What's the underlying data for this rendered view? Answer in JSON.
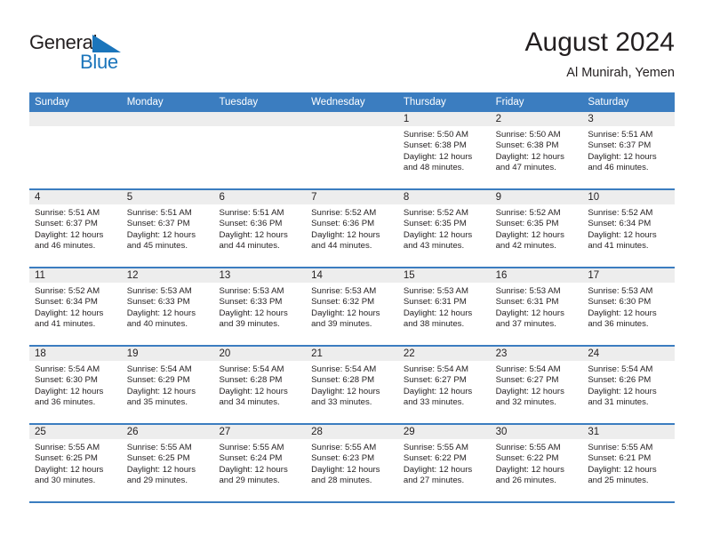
{
  "brand": {
    "word_one": "General",
    "word_two": "Blue",
    "mark": "triangle-logo-icon",
    "accent_color": "#1b75bb"
  },
  "header": {
    "title": "August 2024",
    "subtitle": "Al Munirah, Yemen"
  },
  "colors": {
    "header_blue": "#3b7dc0",
    "day_band_gray": "#ededed",
    "text": "#231f20"
  },
  "weekdays": [
    "Sunday",
    "Monday",
    "Tuesday",
    "Wednesday",
    "Thursday",
    "Friday",
    "Saturday"
  ],
  "weeks": [
    [
      {
        "day": "",
        "empty": true
      },
      {
        "day": "",
        "empty": true
      },
      {
        "day": "",
        "empty": true
      },
      {
        "day": "",
        "empty": true
      },
      {
        "day": "1",
        "sunrise": "Sunrise: 5:50 AM",
        "sunset": "Sunset: 6:38 PM",
        "daylight1": "Daylight: 12 hours",
        "daylight2": "and 48 minutes."
      },
      {
        "day": "2",
        "sunrise": "Sunrise: 5:50 AM",
        "sunset": "Sunset: 6:38 PM",
        "daylight1": "Daylight: 12 hours",
        "daylight2": "and 47 minutes."
      },
      {
        "day": "3",
        "sunrise": "Sunrise: 5:51 AM",
        "sunset": "Sunset: 6:37 PM",
        "daylight1": "Daylight: 12 hours",
        "daylight2": "and 46 minutes."
      }
    ],
    [
      {
        "day": "4",
        "sunrise": "Sunrise: 5:51 AM",
        "sunset": "Sunset: 6:37 PM",
        "daylight1": "Daylight: 12 hours",
        "daylight2": "and 46 minutes."
      },
      {
        "day": "5",
        "sunrise": "Sunrise: 5:51 AM",
        "sunset": "Sunset: 6:37 PM",
        "daylight1": "Daylight: 12 hours",
        "daylight2": "and 45 minutes."
      },
      {
        "day": "6",
        "sunrise": "Sunrise: 5:51 AM",
        "sunset": "Sunset: 6:36 PM",
        "daylight1": "Daylight: 12 hours",
        "daylight2": "and 44 minutes."
      },
      {
        "day": "7",
        "sunrise": "Sunrise: 5:52 AM",
        "sunset": "Sunset: 6:36 PM",
        "daylight1": "Daylight: 12 hours",
        "daylight2": "and 44 minutes."
      },
      {
        "day": "8",
        "sunrise": "Sunrise: 5:52 AM",
        "sunset": "Sunset: 6:35 PM",
        "daylight1": "Daylight: 12 hours",
        "daylight2": "and 43 minutes."
      },
      {
        "day": "9",
        "sunrise": "Sunrise: 5:52 AM",
        "sunset": "Sunset: 6:35 PM",
        "daylight1": "Daylight: 12 hours",
        "daylight2": "and 42 minutes."
      },
      {
        "day": "10",
        "sunrise": "Sunrise: 5:52 AM",
        "sunset": "Sunset: 6:34 PM",
        "daylight1": "Daylight: 12 hours",
        "daylight2": "and 41 minutes."
      }
    ],
    [
      {
        "day": "11",
        "sunrise": "Sunrise: 5:52 AM",
        "sunset": "Sunset: 6:34 PM",
        "daylight1": "Daylight: 12 hours",
        "daylight2": "and 41 minutes."
      },
      {
        "day": "12",
        "sunrise": "Sunrise: 5:53 AM",
        "sunset": "Sunset: 6:33 PM",
        "daylight1": "Daylight: 12 hours",
        "daylight2": "and 40 minutes."
      },
      {
        "day": "13",
        "sunrise": "Sunrise: 5:53 AM",
        "sunset": "Sunset: 6:33 PM",
        "daylight1": "Daylight: 12 hours",
        "daylight2": "and 39 minutes."
      },
      {
        "day": "14",
        "sunrise": "Sunrise: 5:53 AM",
        "sunset": "Sunset: 6:32 PM",
        "daylight1": "Daylight: 12 hours",
        "daylight2": "and 39 minutes."
      },
      {
        "day": "15",
        "sunrise": "Sunrise: 5:53 AM",
        "sunset": "Sunset: 6:31 PM",
        "daylight1": "Daylight: 12 hours",
        "daylight2": "and 38 minutes."
      },
      {
        "day": "16",
        "sunrise": "Sunrise: 5:53 AM",
        "sunset": "Sunset: 6:31 PM",
        "daylight1": "Daylight: 12 hours",
        "daylight2": "and 37 minutes."
      },
      {
        "day": "17",
        "sunrise": "Sunrise: 5:53 AM",
        "sunset": "Sunset: 6:30 PM",
        "daylight1": "Daylight: 12 hours",
        "daylight2": "and 36 minutes."
      }
    ],
    [
      {
        "day": "18",
        "sunrise": "Sunrise: 5:54 AM",
        "sunset": "Sunset: 6:30 PM",
        "daylight1": "Daylight: 12 hours",
        "daylight2": "and 36 minutes."
      },
      {
        "day": "19",
        "sunrise": "Sunrise: 5:54 AM",
        "sunset": "Sunset: 6:29 PM",
        "daylight1": "Daylight: 12 hours",
        "daylight2": "and 35 minutes."
      },
      {
        "day": "20",
        "sunrise": "Sunrise: 5:54 AM",
        "sunset": "Sunset: 6:28 PM",
        "daylight1": "Daylight: 12 hours",
        "daylight2": "and 34 minutes."
      },
      {
        "day": "21",
        "sunrise": "Sunrise: 5:54 AM",
        "sunset": "Sunset: 6:28 PM",
        "daylight1": "Daylight: 12 hours",
        "daylight2": "and 33 minutes."
      },
      {
        "day": "22",
        "sunrise": "Sunrise: 5:54 AM",
        "sunset": "Sunset: 6:27 PM",
        "daylight1": "Daylight: 12 hours",
        "daylight2": "and 33 minutes."
      },
      {
        "day": "23",
        "sunrise": "Sunrise: 5:54 AM",
        "sunset": "Sunset: 6:27 PM",
        "daylight1": "Daylight: 12 hours",
        "daylight2": "and 32 minutes."
      },
      {
        "day": "24",
        "sunrise": "Sunrise: 5:54 AM",
        "sunset": "Sunset: 6:26 PM",
        "daylight1": "Daylight: 12 hours",
        "daylight2": "and 31 minutes."
      }
    ],
    [
      {
        "day": "25",
        "sunrise": "Sunrise: 5:55 AM",
        "sunset": "Sunset: 6:25 PM",
        "daylight1": "Daylight: 12 hours",
        "daylight2": "and 30 minutes."
      },
      {
        "day": "26",
        "sunrise": "Sunrise: 5:55 AM",
        "sunset": "Sunset: 6:25 PM",
        "daylight1": "Daylight: 12 hours",
        "daylight2": "and 29 minutes."
      },
      {
        "day": "27",
        "sunrise": "Sunrise: 5:55 AM",
        "sunset": "Sunset: 6:24 PM",
        "daylight1": "Daylight: 12 hours",
        "daylight2": "and 29 minutes."
      },
      {
        "day": "28",
        "sunrise": "Sunrise: 5:55 AM",
        "sunset": "Sunset: 6:23 PM",
        "daylight1": "Daylight: 12 hours",
        "daylight2": "and 28 minutes."
      },
      {
        "day": "29",
        "sunrise": "Sunrise: 5:55 AM",
        "sunset": "Sunset: 6:22 PM",
        "daylight1": "Daylight: 12 hours",
        "daylight2": "and 27 minutes."
      },
      {
        "day": "30",
        "sunrise": "Sunrise: 5:55 AM",
        "sunset": "Sunset: 6:22 PM",
        "daylight1": "Daylight: 12 hours",
        "daylight2": "and 26 minutes."
      },
      {
        "day": "31",
        "sunrise": "Sunrise: 5:55 AM",
        "sunset": "Sunset: 6:21 PM",
        "daylight1": "Daylight: 12 hours",
        "daylight2": "and 25 minutes."
      }
    ]
  ]
}
